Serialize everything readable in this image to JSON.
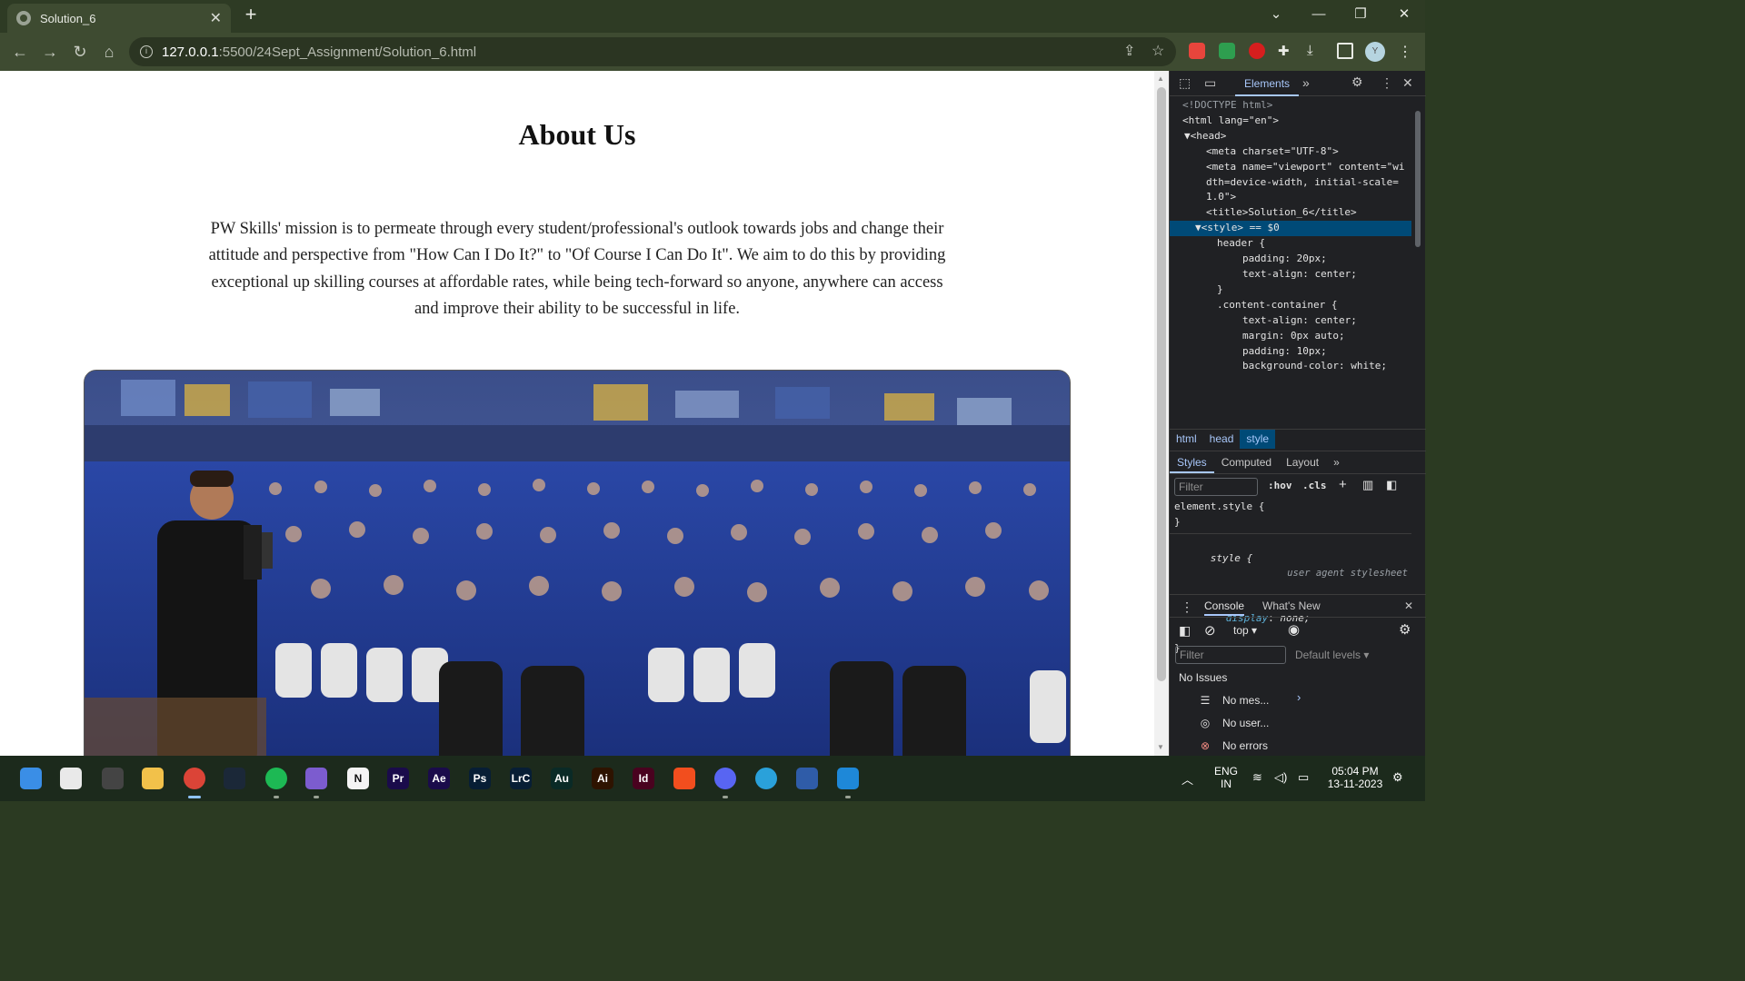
{
  "browser": {
    "tab_title": "Solution_6",
    "tab_close": "✕",
    "new_tab": "+",
    "url_host": "127.0.0.1",
    "url_path": ":5500/24Sept_Assignment/Solution_6.html"
  },
  "page": {
    "title": "About Us",
    "mission": "PW Skills' mission is to permeate through every student/professional's outlook towards jobs and change their attitude and perspective from \"How Can I Do It?\" to \"Of Course I Can Do It\". We aim to do this by providing exceptional up skilling courses at affordable rates, while being tech-forward so anyone, anywhere can access and improve their ability to be successful in life."
  },
  "devtools": {
    "elements_tab": "Elements",
    "code_lines": [
      "<!DOCTYPE html>",
      "<html lang=\"en\">",
      "▼<head>",
      "<meta charset=\"UTF-8\">",
      "<meta name=\"viewport\" content=\"wi",
      "dth=device-width, initial-scale=",
      "1.0\">",
      "<title>Solution_6</title>",
      "▼<style> == $0",
      "header {",
      "",
      "padding: 20px;",
      "text-align: center;",
      "}",
      "",
      "",
      ".content-container {",
      "text-align: center;",
      "margin: 0px auto;",
      "padding: 10px;",
      "background-color: white;"
    ],
    "breadcrumbs": [
      "html",
      "head",
      "style"
    ],
    "subtabs": [
      "Styles",
      "Computed",
      "Layout"
    ],
    "filter_placeholder": "Filter",
    "hov": ":hov",
    "cls": ".cls",
    "styles": {
      "element_style_open": "element.style {",
      "element_style_close": "}",
      "style_open": "style {",
      "ua_label": "user agent stylesheet",
      "display_prop": "display",
      "display_val": "none;",
      "style_close": "}"
    },
    "console_tab": "Console",
    "whats_new_tab": "What's New",
    "context": "top",
    "console_filter": "Filter",
    "default_levels": "Default levels",
    "no_issues": "No Issues",
    "messages": [
      {
        "icon": "list-icon",
        "text": "No mes..."
      },
      {
        "icon": "user-icon",
        "text": "No user..."
      },
      {
        "icon": "error-icon",
        "text": "No errors"
      }
    ]
  },
  "taskbar": {
    "icons": [
      {
        "name": "start-icon",
        "label": "",
        "color": "#3a8ee6"
      },
      {
        "name": "store-icon",
        "label": "",
        "color": "#e9e9e9"
      },
      {
        "name": "obs-icon",
        "label": "",
        "color": "#444444"
      },
      {
        "name": "explorer-icon",
        "label": "",
        "color": "#f2c14a"
      },
      {
        "name": "chrome-icon",
        "label": "",
        "color": "#db4437"
      },
      {
        "name": "steam-icon",
        "label": "",
        "color": "#1b2838"
      },
      {
        "name": "spotify-icon",
        "label": "",
        "color": "#1db954"
      },
      {
        "name": "obsidian-icon",
        "label": "",
        "color": "#7c5ccf"
      },
      {
        "name": "notion-icon",
        "label": "N",
        "color": "#f4f4f4"
      },
      {
        "name": "premiere-icon",
        "label": "Pr",
        "color": "#1a0b4b"
      },
      {
        "name": "after-effects-icon",
        "label": "Ae",
        "color": "#1a0b4b"
      },
      {
        "name": "photoshop-icon",
        "label": "Ps",
        "color": "#071e35"
      },
      {
        "name": "lightroom-classic-icon",
        "label": "LrC",
        "color": "#071e35"
      },
      {
        "name": "audition-icon",
        "label": "Au",
        "color": "#0a2a26"
      },
      {
        "name": "illustrator-icon",
        "label": "Ai",
        "color": "#2e1300"
      },
      {
        "name": "indesign-icon",
        "label": "Id",
        "color": "#49021f"
      },
      {
        "name": "figma-icon",
        "label": "",
        "color": "#f24e1e"
      },
      {
        "name": "discord-icon",
        "label": "",
        "color": "#5865f2"
      },
      {
        "name": "telegram-icon",
        "label": "",
        "color": "#2aa1da"
      },
      {
        "name": "davinci-icon",
        "label": "",
        "color": "#2f5ca8"
      },
      {
        "name": "vscode-icon",
        "label": "",
        "color": "#1e88d8"
      }
    ],
    "language_line1": "ENG",
    "language_line2": "IN",
    "time": "05:04 PM",
    "date": "13-11-2023"
  }
}
